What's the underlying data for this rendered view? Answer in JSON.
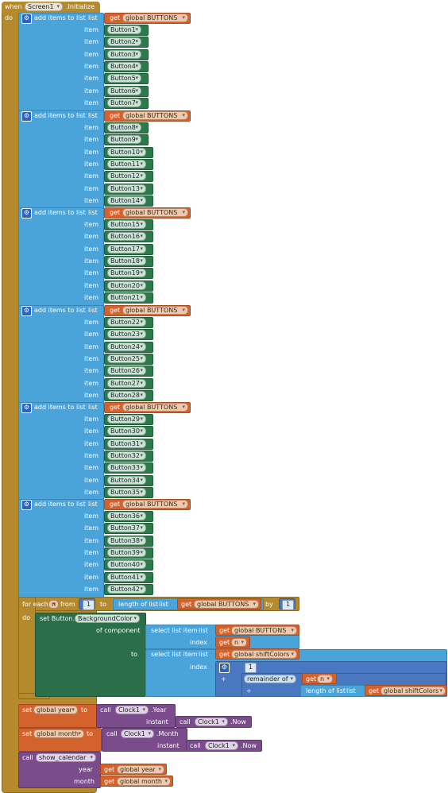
{
  "event": {
    "when": "when",
    "component": "Screen1",
    "event_name": ".Initialize",
    "do": "do"
  },
  "add_items": {
    "label": "add items to list",
    "list_label": "list",
    "item_label": "item"
  },
  "get": {
    "label": "get",
    "buttons_var": "global BUTTONS"
  },
  "button_groups": [
    [
      "Button1",
      "Button2",
      "Button3",
      "Button4",
      "Button5",
      "Button6",
      "Button7"
    ],
    [
      "Button8",
      "Button9",
      "Button10",
      "Button11",
      "Button12",
      "Button13",
      "Button14"
    ],
    [
      "Button15",
      "Button16",
      "Button17",
      "Button18",
      "Button19",
      "Button20",
      "Button21"
    ],
    [
      "Button22",
      "Button23",
      "Button24",
      "Button25",
      "Button26",
      "Button27",
      "Button28"
    ],
    [
      "Button29",
      "Button30",
      "Button31",
      "Button32",
      "Button33",
      "Button34",
      "Button35"
    ],
    [
      "Button36",
      "Button37",
      "Button38",
      "Button39",
      "Button40",
      "Button41",
      "Button42"
    ]
  ],
  "for_each": {
    "label": "for each",
    "var": "n",
    "from": "from",
    "from_value": "1",
    "to": "to",
    "length_label": "length of list",
    "list_label": "list",
    "by": "by",
    "by_value": "1",
    "do": "do"
  },
  "set_button": {
    "set_label": "set Button.",
    "property": "BackgroundColor",
    "of_component": "of component",
    "to": "to",
    "select_label": "select list item",
    "list_label": "list",
    "index_label": "index",
    "var_n": "n",
    "buttons_var": "global BUTTONS",
    "shift_colors_var": "global shiftColors",
    "one": "1",
    "plus": "+",
    "remainder": "remainder of",
    "plus2": "+",
    "length_label": "length of list"
  },
  "set_year": {
    "set": "set",
    "var": "global year",
    "to": "to",
    "call": "call",
    "clock": "Clock1",
    "method": ".Year",
    "instant": "instant",
    "now_method": ".Now"
  },
  "set_month": {
    "set": "set",
    "var": "global month",
    "to": "to",
    "call": "call",
    "clock": "Clock1",
    "method": ".Month",
    "instant": "instant",
    "now_method": ".Now"
  },
  "call_show": {
    "call": "call",
    "procedure": "show_calendar",
    "year_label": "year",
    "month_label": "month",
    "year_var": "global year",
    "month_var": "global month"
  }
}
